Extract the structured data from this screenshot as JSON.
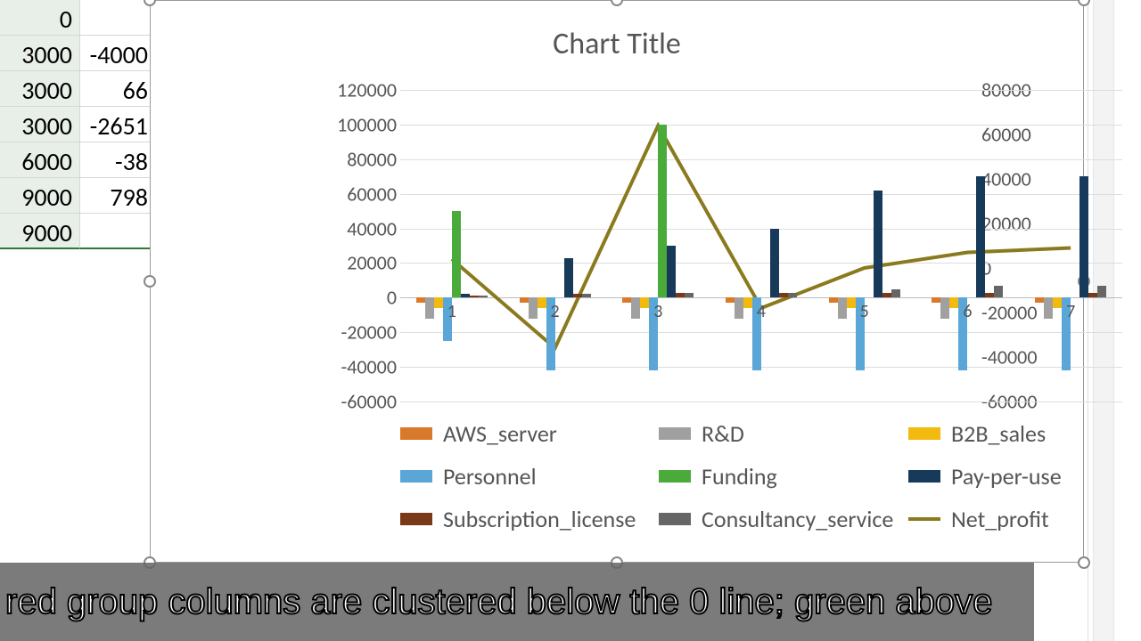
{
  "cells": {
    "rows": [
      {
        "a": "0",
        "b": ""
      },
      {
        "a": "3000",
        "b": "-4000"
      },
      {
        "a": "3000",
        "b": "66"
      },
      {
        "a": "3000",
        "b": "-2651"
      },
      {
        "a": "6000",
        "b": "-38"
      },
      {
        "a": "9000",
        "b": "798"
      },
      {
        "a": "9000",
        "b": ""
      }
    ]
  },
  "chart_data": {
    "type": "bar",
    "title": "Chart Title",
    "categories": [
      "1",
      "2",
      "3",
      "4",
      "5",
      "6",
      "7"
    ],
    "left_axis": {
      "min": -60000,
      "max": 120000,
      "step": 20000
    },
    "right_axis": {
      "min": -60000,
      "max": 80000,
      "step": 20000
    },
    "series": [
      {
        "name": "AWS_server",
        "color": "#d97a2a",
        "axis": "left",
        "values": [
          -3000,
          -3000,
          -3000,
          -3000,
          -3000,
          -3000,
          -3000
        ]
      },
      {
        "name": "R&D",
        "color": "#a0a0a0",
        "axis": "left",
        "values": [
          -12000,
          -12000,
          -12000,
          -12000,
          -12000,
          -12000,
          -12000
        ]
      },
      {
        "name": "B2B_sales",
        "color": "#f2b90f",
        "axis": "left",
        "values": [
          -6000,
          -6000,
          -6000,
          -6000,
          -6000,
          -6000,
          -6000
        ]
      },
      {
        "name": "Personnel",
        "color": "#5aa6d6",
        "axis": "left",
        "values": [
          -25000,
          -42000,
          -42000,
          -42000,
          -42000,
          -42000,
          -42000
        ]
      },
      {
        "name": "Funding",
        "color": "#4aab3a",
        "axis": "left",
        "values": [
          50000,
          0,
          100000,
          0,
          0,
          0,
          0
        ]
      },
      {
        "name": "Pay-per-use",
        "color": "#183a5a",
        "axis": "left",
        "values": [
          2000,
          23000,
          30000,
          40000,
          62000,
          70000,
          70000
        ]
      },
      {
        "name": "Subscription_license",
        "color": "#7a3a1a",
        "axis": "left",
        "values": [
          1000,
          2000,
          3000,
          3000,
          3000,
          3000,
          3000
        ]
      },
      {
        "name": "Consultancy_service",
        "color": "#666666",
        "axis": "left",
        "values": [
          1000,
          2000,
          3000,
          3000,
          5000,
          7000,
          7000
        ]
      }
    ],
    "line_series": {
      "name": "Net_profit",
      "color": "#8a7a1e",
      "axis": "right",
      "values": [
        4000,
        -36000,
        64000,
        -18000,
        0,
        7000,
        9000
      ]
    },
    "legend": [
      {
        "name": "AWS_server",
        "color": "#d97a2a",
        "shape": "box"
      },
      {
        "name": "R&D",
        "color": "#a0a0a0",
        "shape": "box"
      },
      {
        "name": "B2B_sales",
        "color": "#f2b90f",
        "shape": "box"
      },
      {
        "name": "Personnel",
        "color": "#5aa6d6",
        "shape": "box"
      },
      {
        "name": "Funding",
        "color": "#4aab3a",
        "shape": "box"
      },
      {
        "name": "Pay-per-use",
        "color": "#183a5a",
        "shape": "box"
      },
      {
        "name": "Subscription_license",
        "color": "#7a3a1a",
        "shape": "box"
      },
      {
        "name": "Consultancy_service",
        "color": "#666666",
        "shape": "box"
      },
      {
        "name": "Net_profit",
        "color": "#8a7a1e",
        "shape": "line"
      }
    ]
  },
  "caption": "red group columns are clustered below the 0 line; green above"
}
